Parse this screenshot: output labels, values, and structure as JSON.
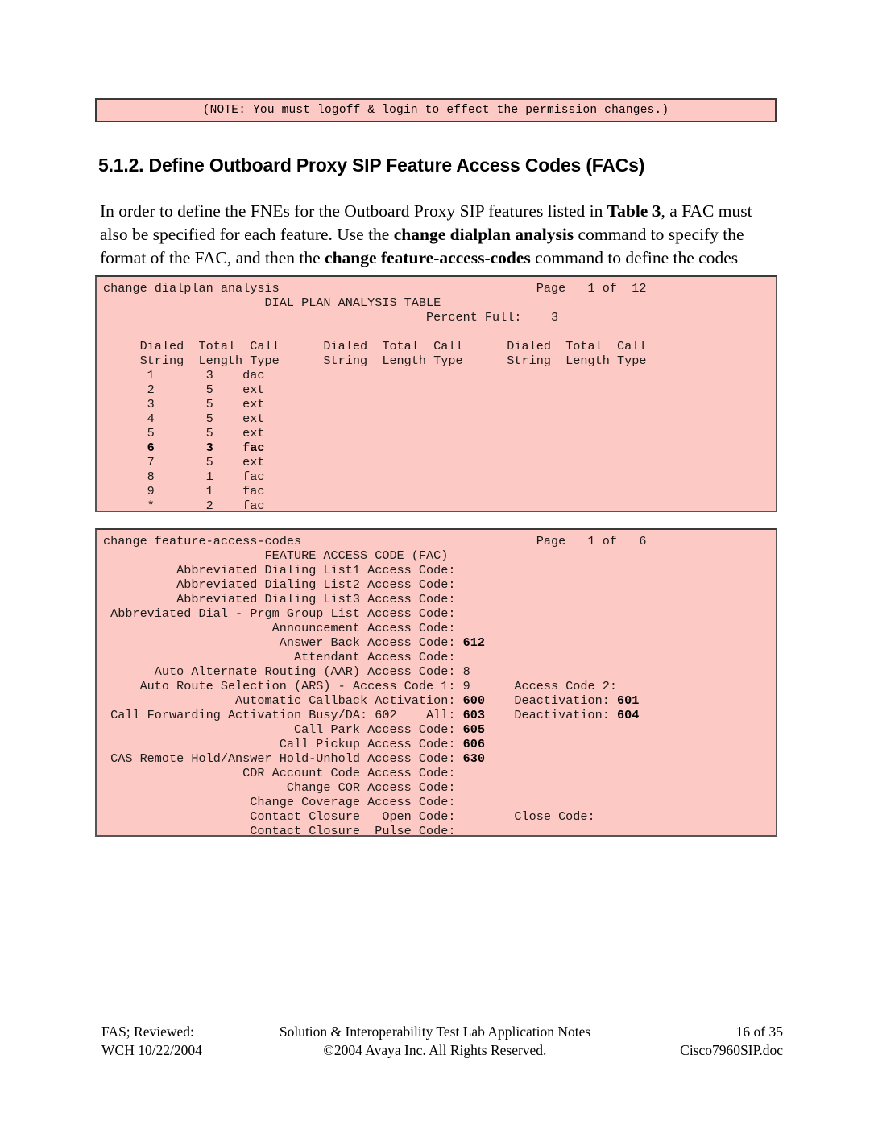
{
  "note": {
    "text": "(NOTE: You must logoff & login to effect the permission changes.)"
  },
  "section": {
    "heading": "5.1.2. Define Outboard Proxy SIP Feature Access Codes (FACs)",
    "paragraph_parts": {
      "p1": "In order to define the FNEs for the Outboard Proxy SIP features listed in ",
      "b1": "Table 3",
      "p2": ", a FAC must also be specified for each feature.  Use the ",
      "b2": "change dialplan analysis",
      "p3": " command to specify the format of the FAC, and then the ",
      "b3": "change feature-access-codes",
      "p4": " command to define the codes themselves."
    }
  },
  "terminal_dialplan": {
    "command": "change dialplan analysis",
    "page_label": "Page   1 of  12",
    "screen_title": "DIAL PLAN ANALYSIS TABLE",
    "percent_full_label": "Percent Full:",
    "percent_full_value": "3",
    "lines": [
      "change dialplan analysis                             Page   1 of  12",
      "                        DIAL PLAN ANALYSIS TABLE",
      "                                            Percent Full:     3",
      "",
      "    Dialed  Total  Call      Dialed  Total  Call      Dialed  Total  Call",
      "    String  Length Type      String  Length Type      String  Length Type",
      "      1       3    dac",
      "      2       5    ext",
      "      3       5    ext",
      "      4       5    ext",
      "      5       5    ext",
      "      6       3    fac",
      "      7       5    ext",
      "      8       1    fac",
      "      9       1    fac",
      "      *       2    fac"
    ],
    "columns": [
      "Dialed String",
      "Total Length",
      "Call Type"
    ],
    "rows": [
      {
        "dialed_string": "1",
        "total_length": "3",
        "call_type": "dac",
        "bold": false
      },
      {
        "dialed_string": "2",
        "total_length": "5",
        "call_type": "ext",
        "bold": false
      },
      {
        "dialed_string": "3",
        "total_length": "5",
        "call_type": "ext",
        "bold": false
      },
      {
        "dialed_string": "4",
        "total_length": "5",
        "call_type": "ext",
        "bold": false
      },
      {
        "dialed_string": "5",
        "total_length": "5",
        "call_type": "ext",
        "bold": false
      },
      {
        "dialed_string": "6",
        "total_length": "3",
        "call_type": "fac",
        "bold": true
      },
      {
        "dialed_string": "7",
        "total_length": "5",
        "call_type": "ext",
        "bold": false
      },
      {
        "dialed_string": "8",
        "total_length": "1",
        "call_type": "fac",
        "bold": false
      },
      {
        "dialed_string": "9",
        "total_length": "1",
        "call_type": "fac",
        "bold": false
      },
      {
        "dialed_string": "*",
        "total_length": "2",
        "call_type": "fac",
        "bold": false
      }
    ]
  },
  "terminal_fac": {
    "command": "change feature-access-codes",
    "page_label": "Page   1 of   6",
    "screen_title": "FEATURE ACCESS CODE (FAC)",
    "entries": [
      {
        "label": "Abbreviated Dialing List1 Access Code:",
        "value": "",
        "bold": false
      },
      {
        "label": "Abbreviated Dialing List2 Access Code:",
        "value": "",
        "bold": false
      },
      {
        "label": "Abbreviated Dialing List3 Access Code:",
        "value": "",
        "bold": false
      },
      {
        "label": "Abbreviated Dial - Prgm Group List Access Code:",
        "value": "",
        "bold": false
      },
      {
        "label": "Announcement Access Code:",
        "value": "",
        "bold": false
      },
      {
        "label": "Answer Back Access Code:",
        "value": "612",
        "bold": true
      },
      {
        "label": "Attendant Access Code:",
        "value": "",
        "bold": false
      },
      {
        "label": "Auto Alternate Routing (AAR) Access Code:",
        "value": "8",
        "bold": false
      },
      {
        "label": "Auto Route Selection (ARS) - Access Code 1:",
        "value": "9",
        "bold": false,
        "extra_label": "Access Code 2:",
        "extra_value": ""
      },
      {
        "label": "Automatic Callback Activation:",
        "value": "600",
        "bold": true,
        "extra_label": "Deactivation:",
        "extra_value": "601"
      },
      {
        "label": "Call Forwarding Activation Busy/DA: 602    All:",
        "value": "603",
        "bold": true,
        "extra_label": "Deactivation:",
        "extra_value": "604"
      },
      {
        "label": "Call Park Access Code:",
        "value": "605",
        "bold": true
      },
      {
        "label": "Call Pickup Access Code:",
        "value": "606",
        "bold": true
      },
      {
        "label": "CAS Remote Hold/Answer Hold-Unhold Access Code:",
        "value": "630",
        "bold": true
      },
      {
        "label": "CDR Account Code Access Code:",
        "value": "",
        "bold": false
      },
      {
        "label": "Change COR Access Code:",
        "value": "",
        "bold": false
      },
      {
        "label": "Change Coverage Access Code:",
        "value": "",
        "bold": false
      },
      {
        "label": "Contact Closure   Open Code:",
        "value": "",
        "bold": false,
        "extra_label": "Close Code:",
        "extra_value": ""
      },
      {
        "label": "Contact Closure  Pulse Code:",
        "value": "",
        "bold": false
      }
    ]
  },
  "footer": {
    "left_line1": "FAS; Reviewed:",
    "left_line2": "WCH 10/22/2004",
    "center_line1": "Solution & Interoperability Test Lab Application Notes",
    "center_line2": "©2004 Avaya Inc. All Rights Reserved.",
    "right_line1": "16 of 35",
    "right_line2": "Cisco7960SIP.doc"
  },
  "colors": {
    "terminal_background": "#fcc9c4",
    "terminal_border": "#555555",
    "page_background": "#ffffff",
    "text": "#000000"
  }
}
